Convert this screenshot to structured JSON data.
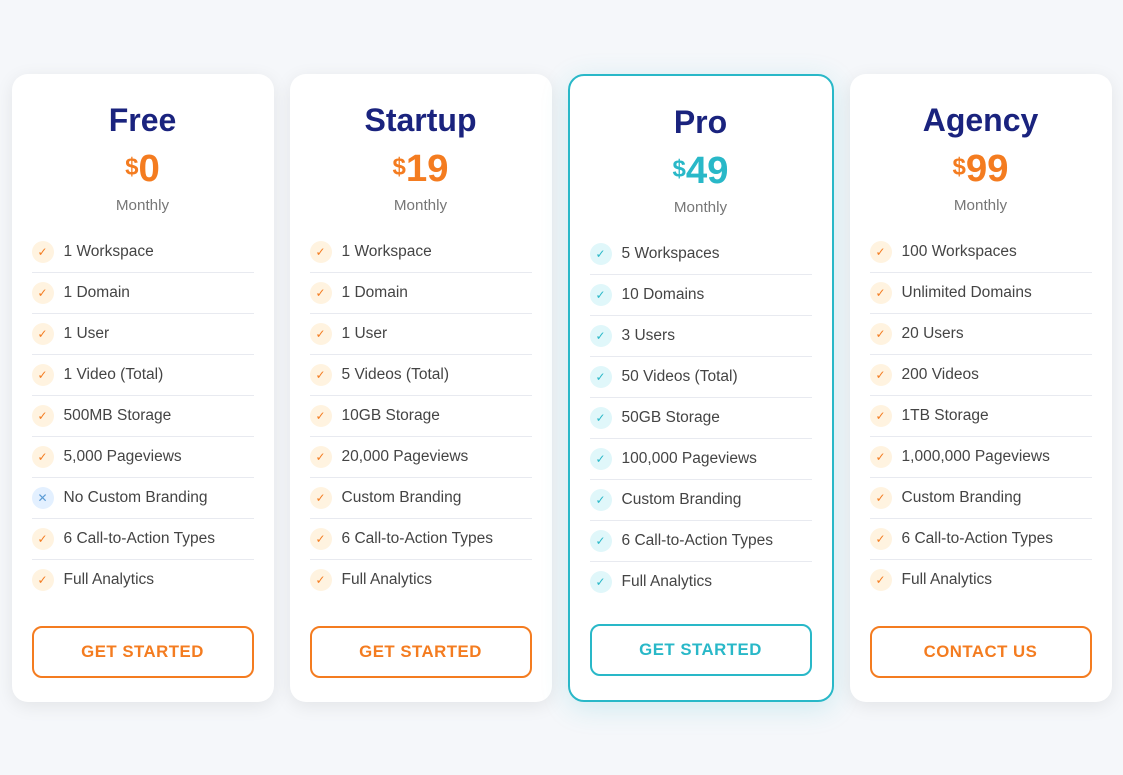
{
  "plans": [
    {
      "id": "free",
      "name": "Free",
      "price": "0",
      "period": "Monthly",
      "featured": false,
      "features": [
        {
          "text": "1 Workspace",
          "icon": "check",
          "type": "orange"
        },
        {
          "text": "1 Domain",
          "icon": "check",
          "type": "orange"
        },
        {
          "text": "1 User",
          "icon": "check",
          "type": "orange"
        },
        {
          "text": "1 Video (Total)",
          "icon": "check",
          "type": "orange"
        },
        {
          "text": "500MB Storage",
          "icon": "check",
          "type": "orange"
        },
        {
          "text": "5,000 Pageviews",
          "icon": "check",
          "type": "orange"
        },
        {
          "text": "No Custom Branding",
          "icon": "cross",
          "type": "cross"
        },
        {
          "text": "6 Call-to-Action Types",
          "icon": "check",
          "type": "orange"
        },
        {
          "text": "Full Analytics",
          "icon": "check",
          "type": "orange"
        }
      ],
      "cta": "GET STARTED"
    },
    {
      "id": "startup",
      "name": "Startup",
      "price": "19",
      "period": "Monthly",
      "featured": false,
      "features": [
        {
          "text": "1 Workspace",
          "icon": "check",
          "type": "orange"
        },
        {
          "text": "1 Domain",
          "icon": "check",
          "type": "orange"
        },
        {
          "text": "1 User",
          "icon": "check",
          "type": "orange"
        },
        {
          "text": "5 Videos (Total)",
          "icon": "check",
          "type": "orange"
        },
        {
          "text": "10GB Storage",
          "icon": "check",
          "type": "orange"
        },
        {
          "text": "20,000 Pageviews",
          "icon": "check",
          "type": "orange"
        },
        {
          "text": "Custom Branding",
          "icon": "check",
          "type": "orange"
        },
        {
          "text": "6 Call-to-Action Types",
          "icon": "check",
          "type": "orange"
        },
        {
          "text": "Full Analytics",
          "icon": "check",
          "type": "orange"
        }
      ],
      "cta": "GET STARTED"
    },
    {
      "id": "pro",
      "name": "Pro",
      "price": "49",
      "period": "Monthly",
      "featured": true,
      "features": [
        {
          "text": "5 Workspaces",
          "icon": "check",
          "type": "teal"
        },
        {
          "text": "10 Domains",
          "icon": "check",
          "type": "teal"
        },
        {
          "text": "3 Users",
          "icon": "check",
          "type": "teal"
        },
        {
          "text": "50 Videos (Total)",
          "icon": "check",
          "type": "teal"
        },
        {
          "text": "50GB Storage",
          "icon": "check",
          "type": "teal"
        },
        {
          "text": "100,000 Pageviews",
          "icon": "check",
          "type": "teal"
        },
        {
          "text": "Custom Branding",
          "icon": "check",
          "type": "teal"
        },
        {
          "text": "6 Call-to-Action Types",
          "icon": "check",
          "type": "teal"
        },
        {
          "text": "Full Analytics",
          "icon": "check",
          "type": "teal"
        }
      ],
      "cta": "GET STARTED"
    },
    {
      "id": "agency",
      "name": "Agency",
      "price": "99",
      "period": "Monthly",
      "featured": false,
      "features": [
        {
          "text": "100 Workspaces",
          "icon": "check",
          "type": "orange"
        },
        {
          "text": "Unlimited Domains",
          "icon": "check",
          "type": "orange"
        },
        {
          "text": "20 Users",
          "icon": "check",
          "type": "orange"
        },
        {
          "text": "200 Videos",
          "icon": "check",
          "type": "orange"
        },
        {
          "text": "1TB Storage",
          "icon": "check",
          "type": "orange"
        },
        {
          "text": "1,000,000 Pageviews",
          "icon": "check",
          "type": "orange"
        },
        {
          "text": "Custom Branding",
          "icon": "check",
          "type": "orange"
        },
        {
          "text": "6 Call-to-Action Types",
          "icon": "check",
          "type": "orange"
        },
        {
          "text": "Full Analytics",
          "icon": "check",
          "type": "orange"
        }
      ],
      "cta": "CONTACT US"
    }
  ]
}
